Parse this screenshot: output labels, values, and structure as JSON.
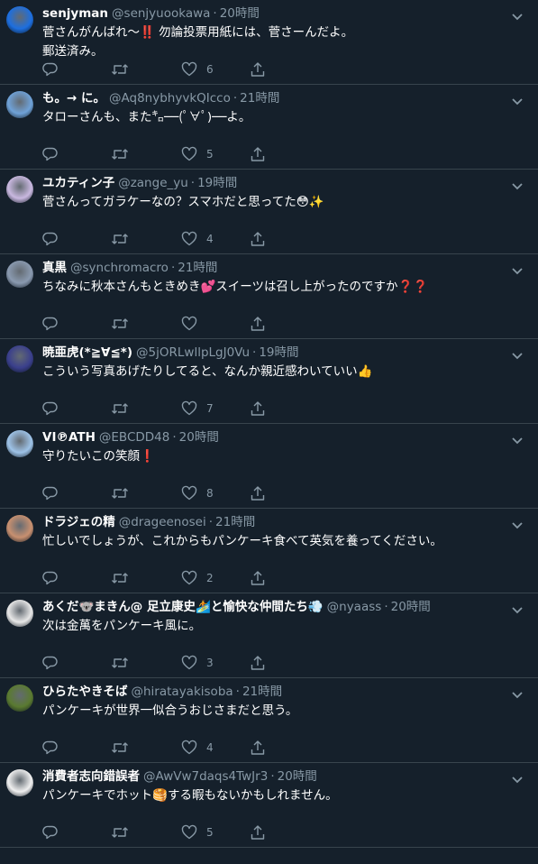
{
  "tweets": [
    {
      "name": "senjyman",
      "handle": "@senjyuookawa",
      "dot": "·",
      "time": "20時間",
      "body": "菅さんがんばれ〜‼️ 勿論投票用紙には、菅さーんだよ。\n郵送済み。",
      "likes": "6",
      "avatar_color": "#1d6fe0"
    },
    {
      "name": "も。→ に。",
      "handle": "@Aq8nybhyvkQIcco",
      "dot": "·",
      "time": "21時間",
      "body": "タローさんも、また㌔──(ﾟ∀ﾟ)──よ。",
      "likes": "5",
      "avatar_color": "#6fa2d8"
    },
    {
      "name": "ユカティン子",
      "handle": "@zange_yu",
      "dot": "·",
      "time": "19時間",
      "body": "菅さんってガラケーなの？スマホだと思ってた😳✨",
      "likes": "4",
      "avatar_color": "#c9b8e0"
    },
    {
      "name": "真黒",
      "handle": "@synchromacro",
      "dot": "·",
      "time": "21時間",
      "body": "ちなみに秋本さんもときめき💕スイーツは召し上がったのですか❓❓",
      "likes": "",
      "avatar_color": "#8a9ab0"
    },
    {
      "name": "暁亜虎(*≧∀≦*)",
      "handle": "@5jORLwllpLgJ0Vu",
      "dot": "·",
      "time": "19時間",
      "body": "こういう写真あげたりしてると、なんか親近感わいていい👍",
      "likes": "7",
      "avatar_color": "#3a3f8c"
    },
    {
      "name": "VI℗ATH",
      "handle": "@EBCDD48",
      "dot": "·",
      "time": "20時間",
      "body": "守りたいこの笑顔❗",
      "likes": "8",
      "avatar_color": "#9ec3e8"
    },
    {
      "name": "ドラジェの精",
      "handle": "@drageenosei",
      "dot": "·",
      "time": "21時間",
      "body": "忙しいでしょうが、これからもパンケーキ食べて英気を養ってください。",
      "likes": "2",
      "avatar_color": "#c89070"
    },
    {
      "name": "あくだ🐨まきん@ 足立康史🏄と愉快な仲間たち💨",
      "handle": "@nyaass",
      "dot": "·",
      "time": "20時間",
      "body": "次は金萬をパンケーキ風に。",
      "likes": "3",
      "avatar_color": "#e8e8e8"
    },
    {
      "name": "ひらたやきそば",
      "handle": "@hiratayakisoba",
      "dot": "·",
      "time": "21時間",
      "body": "パンケーキが世界一似合うおじさまだと思う。",
      "likes": "4",
      "avatar_color": "#5a7a30"
    },
    {
      "name": "消費者志向錯誤者",
      "handle": "@AwVw7daqs4TwJr3",
      "dot": "·",
      "time": "20時間",
      "body": "パンケーキでホット🥞する暇もないかもしれません。",
      "likes": "5",
      "avatar_color": "#f0f0f0"
    }
  ]
}
